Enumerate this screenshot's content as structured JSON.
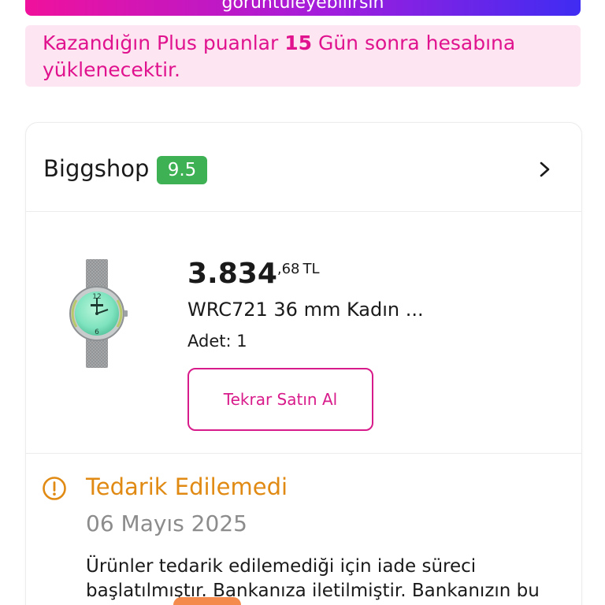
{
  "banner": {
    "text": "görüntüleyebilirsin"
  },
  "plus_notice": {
    "prefix": "Kazandığın Plus puanlar ",
    "days": "15",
    "suffix": " Gün sonra hesabına yüklenecektir."
  },
  "seller": {
    "name": "Biggshop",
    "score": "9.5",
    "chevron_icon": "chevron-right-icon"
  },
  "product": {
    "image_icon": "wristwatch-image",
    "price_main": "3.834",
    "price_fraction": ",68",
    "price_currency": "TL",
    "name": "WRC721 36 mm Kadın ...",
    "quantity": "Adet: 1",
    "rebuy_label": "Tekrar Satın Al"
  },
  "status": {
    "icon": "warning-circle-icon",
    "title": "Tedarik Edilemedi",
    "date": "06 Mayıs 2025",
    "description": "Ürünler tedarik edilemediği için iade süreci başlatılmıştır. Bankanıza iletilmiştir. Bankanızın bu"
  },
  "colors": {
    "brand_pink": "#d81b8a",
    "plus_pink": "#e0128e",
    "notice_bg": "#fde6f2",
    "score_green": "#3db153",
    "status_orange": "#e08a13",
    "date_gray": "#8c8c8c"
  }
}
